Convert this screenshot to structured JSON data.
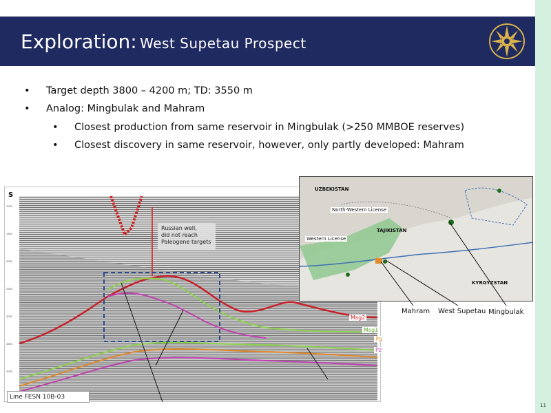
{
  "header": {
    "title_main": "Exploration:",
    "title_sub": "West Supetau Prospect",
    "background": "#1f2a60",
    "logo_icon": "sunburst-logo-icon"
  },
  "bullets": {
    "items": [
      {
        "marker": "•",
        "text": "Target depth 3800 – 4200 m; TD: 3550 m"
      },
      {
        "marker": "•",
        "text": "Analog: Mingbulak and Mahram"
      }
    ],
    "sub_items": [
      {
        "marker": "•",
        "text": "Closest production from same reservoir in Mingbulak (>250 MMBOE reserves)"
      },
      {
        "marker": "•",
        "text": "Closest discovery in same reservoir, however, only partly developed: Mahram"
      }
    ]
  },
  "seismic": {
    "corner_label": "S",
    "annotation": "Russian well,\ndid not reach\nPaleogene targets",
    "horizons": [
      {
        "label": "Msg2",
        "color": "#c8202a"
      },
      {
        "label": "Msg1",
        "color": "#7cc23a"
      },
      {
        "label": "Pg",
        "color": "#e08a2c"
      },
      {
        "label": "Pz",
        "color": "#c040b0"
      }
    ],
    "line_label": "Line FESN 10B-03"
  },
  "map": {
    "country_labels": [
      "UZBEKISTAN",
      "TAJIKISTAN",
      "KYRGYZSTAN"
    ],
    "license_labels": [
      "North-Western License",
      "Western License"
    ],
    "callouts": [
      "Mahram",
      "West Supetau",
      "Mingbulak"
    ]
  },
  "page_number": "11",
  "colors": {
    "side_bar": "#d4f0de",
    "logo_gold": "#d9b24a"
  }
}
